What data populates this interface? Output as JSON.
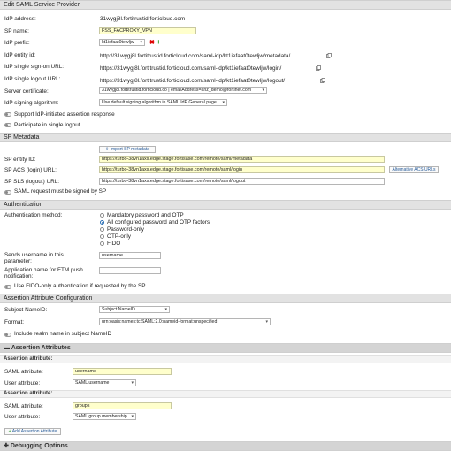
{
  "sections": {
    "edit_saml": "Edit SAML Service Provider",
    "sp_metadata": "SP Metadata",
    "authentication": "Authentication",
    "assertion_config": "Assertion Attribute Configuration",
    "assertion_attributes": "Assertion Attributes",
    "debugging": "Debugging Options"
  },
  "idp": {
    "address_label": "IdP address:",
    "address_value": "31wygj8l.fortitrustid.forticloud.com",
    "sp_name_label": "SP name:",
    "sp_name_value": "FSS_FACPROXY_VPN",
    "prefix_label": "IdP prefix:",
    "prefix_value": "kt1iefaat0tewljw",
    "entity_label": "IdP entity id:",
    "entity_value": "http://31wygj8l.fortitrustid.forticloud.com/saml-idp/kt1iefaat0tewljw/metadata/",
    "signon_label": "IdP single sign-on URL:",
    "signon_value": "https://31wygj8l.fortitrustid.forticloud.com/saml-idp/kt1iefaat0tewljw/login/",
    "logout_label": "IdP single logout URL:",
    "logout_value": "https://31wygj8l.fortitrustid.forticloud.com/saml-idp/kt1iefaat0tewljw/logout/",
    "cert_label": "Server certificate:",
    "cert_value": "31wygj8l.fortitrustid.forticloud.co | emailAddress=anz_demo@fortinet.com",
    "sign_alg_label": "IdP signing algorithm:",
    "sign_alg_value": "Use default signing algorithm in SAML IdP General page",
    "support_idp_label": "Support IdP-initiated assertion response",
    "single_logout_label": "Participate in single logout"
  },
  "sp": {
    "import_button": "Import SP metadata",
    "entity_label": "SP entity ID:",
    "entity_value": "https://turbo-38vn1axs.edge.stage.fortisase.com/remote/saml/metadata",
    "acs_label": "SP ACS (login) URL:",
    "acs_value": "https://turbo-38vn1axs.edge.stage.fortisase.com/remote/saml/login",
    "alt_acs_button": "Alternative ACS URLs",
    "sls_label": "SP SLS (logout) URL:",
    "sls_value": "https://turbo-38vn1axs.edge.stage.fortisase.com/remote/saml/logout",
    "signed_label": "SAML request must be signed by SP"
  },
  "auth": {
    "method_label": "Authentication method:",
    "options": [
      "Mandatory password and OTP",
      "All configured password and OTP factors",
      "Password-only",
      "OTP-only",
      "FIDO"
    ],
    "selected_index": 1,
    "send_username_label_1": "Sends username in this",
    "send_username_label_2": "parameter:",
    "send_username_value": "username",
    "ftm_label_1": "Application name for FTM push",
    "ftm_label_2": "notification:",
    "ftm_value": "",
    "fido_label": "Use FIDO-only authentication if requested by the SP"
  },
  "assertion_cfg": {
    "subject_label": "Subject NameID:",
    "subject_value": "Subject NameID",
    "format_label": "Format:",
    "format_value": "urn:oasis:names:tc:SAML:2.0:nameid-format:unspecified",
    "realm_label": "Include realm name in subject NameID"
  },
  "attributes": [
    {
      "header": "Assertion attribute:",
      "saml_label": "SAML attribute:",
      "saml_value": "username",
      "user_label": "User attribute:",
      "user_value": "SAML username"
    },
    {
      "header": "Assertion attribute:",
      "saml_label": "SAML attribute:",
      "saml_value": "groups",
      "user_label": "User attribute:",
      "user_value": "SAML group membership"
    }
  ],
  "add_attribute_button": "Add Assertion Attribute",
  "colors": {
    "highlight": "#ffffcc",
    "link": "#2a5d9a",
    "section": "#e2e2e2"
  }
}
